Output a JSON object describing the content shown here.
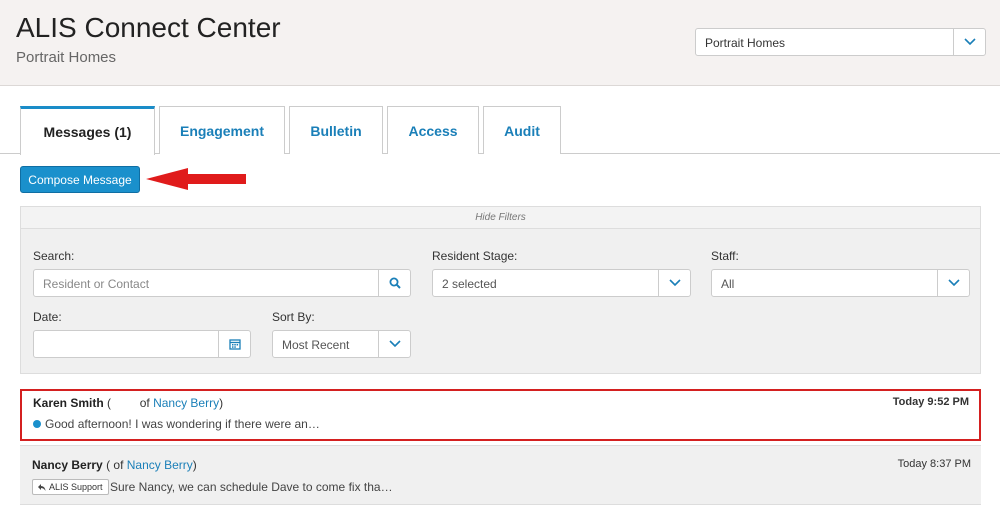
{
  "header": {
    "title": "ALIS Connect Center",
    "subtitle": "Portrait Homes",
    "community_select": "Portrait Homes"
  },
  "tabs": [
    {
      "label": "Messages  (1)",
      "active": true
    },
    {
      "label": "Engagement"
    },
    {
      "label": "Bulletin"
    },
    {
      "label": "Access"
    },
    {
      "label": "Audit"
    }
  ],
  "compose_label": "Compose Message",
  "filters": {
    "toggle_label": "Hide Filters",
    "search_label": "Search:",
    "search_placeholder": "Resident or Contact",
    "stage_label": "Resident Stage:",
    "stage_value": "2 selected",
    "staff_label": "Staff:",
    "staff_value": "All",
    "date_label": "Date:",
    "date_value": "",
    "sort_label": "Sort By:",
    "sort_value": "Most Recent"
  },
  "messages": [
    {
      "sender": "Karen Smith",
      "open_paren": "(",
      "of_text": "of",
      "resident": "Nancy Berry",
      "close_paren": ")",
      "time": "Today 9:52 PM",
      "preview": "Good afternoon! I was wondering if there were an…",
      "unread": true
    },
    {
      "sender": "Nancy Berry",
      "open_paren": "( of",
      "resident": "Nancy Berry",
      "close_paren": ")",
      "time": "Today 8:37 PM",
      "tag": "ALIS Support",
      "preview": "Sure Nancy, we can schedule Dave to come fix tha…"
    }
  ],
  "colors": {
    "accent": "#1a90cc",
    "link": "#1a7fb8",
    "highlight_border": "#d42020",
    "annotation_arrow": "#e01b1b"
  }
}
